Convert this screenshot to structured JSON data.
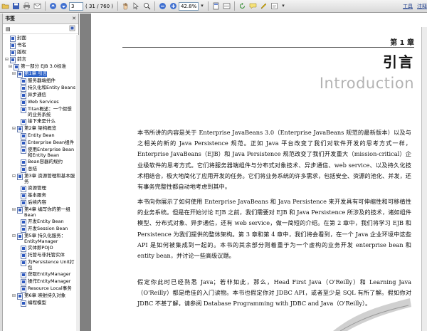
{
  "toolbar": {
    "page_current": "3",
    "page_total": "( 31 / 760 )",
    "zoom": "42.8%",
    "zoom_dropdown": "▾"
  },
  "menu": {
    "tools": "工具",
    "annotate": "注释"
  },
  "bookmarks": {
    "header": "书签",
    "close": "✕",
    "options": "▤",
    "items": [
      {
        "label": "封面",
        "indent": 0,
        "toggle": "",
        "selected": false
      },
      {
        "label": "书名",
        "indent": 0,
        "toggle": "",
        "selected": false
      },
      {
        "label": "版权",
        "indent": 0,
        "toggle": "",
        "selected": false
      },
      {
        "label": "前言",
        "indent": 0,
        "toggle": "⊟",
        "selected": false
      },
      {
        "label": "第一部分 EJB 3.0标准",
        "indent": 1,
        "toggle": "⊟",
        "selected": false
      },
      {
        "label": "第1章 引言",
        "indent": 2,
        "toggle": "⊟",
        "selected": true
      },
      {
        "label": "服务器端组件",
        "indent": 3,
        "toggle": "",
        "selected": false
      },
      {
        "label": "持久化和Entity Beans",
        "indent": 3,
        "toggle": "",
        "selected": false
      },
      {
        "label": "异步通信",
        "indent": 3,
        "toggle": "",
        "selected": false
      },
      {
        "label": "Web Services",
        "indent": 3,
        "toggle": "",
        "selected": false
      },
      {
        "label": "Titan概述：一个假想的业务系统",
        "indent": 3,
        "toggle": "",
        "selected": false
      },
      {
        "label": "接下来是什么",
        "indent": 3,
        "toggle": "",
        "selected": false
      },
      {
        "label": "第2章 架构概览",
        "indent": 2,
        "toggle": "⊟",
        "selected": false
      },
      {
        "label": "Entity Bean",
        "indent": 3,
        "toggle": "",
        "selected": false
      },
      {
        "label": "Enterprise Bean组件",
        "indent": 3,
        "toggle": "",
        "selected": false
      },
      {
        "label": "使用Enterprise Bean和Entity Bean",
        "indent": 3,
        "toggle": "",
        "selected": false
      },
      {
        "label": "Bean容器的规约",
        "indent": 3,
        "toggle": "",
        "selected": false
      },
      {
        "label": "总结",
        "indent": 3,
        "toggle": "",
        "selected": false
      },
      {
        "label": "第3章 资源管理和基本服务",
        "indent": 2,
        "toggle": "⊟",
        "selected": false
      },
      {
        "label": "资源管理",
        "indent": 3,
        "toggle": "",
        "selected": false
      },
      {
        "label": "基本服务",
        "indent": 3,
        "toggle": "",
        "selected": false
      },
      {
        "label": "后续内容",
        "indent": 3,
        "toggle": "",
        "selected": false
      },
      {
        "label": "第4章 编写你的第一组Bean",
        "indent": 2,
        "toggle": "⊟",
        "selected": false
      },
      {
        "label": "开发Entity Bean",
        "indent": 3,
        "toggle": "",
        "selected": false
      },
      {
        "label": "开发Session Bean",
        "indent": 3,
        "toggle": "",
        "selected": false
      },
      {
        "label": "第5章 持久化服务：EntityManager",
        "indent": 2,
        "toggle": "⊟",
        "selected": false
      },
      {
        "label": "实体即POJO",
        "indent": 3,
        "toggle": "",
        "selected": false
      },
      {
        "label": "托管与非托管实体",
        "indent": 3,
        "toggle": "",
        "selected": false
      },
      {
        "label": "为Persistence Unit打包",
        "indent": 3,
        "toggle": "",
        "selected": false
      },
      {
        "label": "获取EntityManager",
        "indent": 3,
        "toggle": "",
        "selected": false
      },
      {
        "label": "操作EntityManager",
        "indent": 3,
        "toggle": "",
        "selected": false
      },
      {
        "label": "Resource Local事务",
        "indent": 3,
        "toggle": "",
        "selected": false
      },
      {
        "label": "第6章 映射持久对象",
        "indent": 2,
        "toggle": "⊟",
        "selected": false
      },
      {
        "label": "编程模型",
        "indent": 3,
        "toggle": "",
        "selected": false
      }
    ]
  },
  "page": {
    "chapter_no": "第 1 章",
    "chapter_title": "引言",
    "chapter_en": "Introduction",
    "p1": "本书所讲的内容是关于 Enterprise JavaBeans 3.0（Enterprise JavaBeans 规范的最新版本）以及与之相关的新的 Java Persistence 规范。正如 Java 平台改变了我们对软件开发的思考方式一样，Enterprise JavaBeans（EJB）和 Java Persistence 规范改变了我们开发重大（mission-critical）企业级软件的思考方式。它们将服务器端组件与分布式对象技术、异步通信、web service、以及持久化技术相结合，极大地简化了应用开发的任务。它们将业务系统的许多需求，包括安全、资源的池化、并发，还有事务完整性都自动地考虑到其中。",
    "p2": "本书向你展示了如何使用 Enterprise JavaBeans 和 Java Persistence 来开发具有可伸缩性和可移植性的业务系统。但是在开始讨论 EJB 之前，我们需要对 EJB 和 Java Persistence 所涉及的技术，诸如组件模型、分布式对象、异步通信，还有 web service，做一简短的介绍。在第 2 章中，我们将学习 EJB 和 Persistence 为我们提供的整体架构。第 3 章和第 4 章中，我们将会看到，在一个 Java 企业环境中这些 API 是如何被集成到一起的。本书的其余部分则着重于为一个虚构的业务开发 enterprise bean 和 entity bean，并讨论一些高级议题。",
    "p3": "假定你此时已经熟悉 Java；若非如此，那么，Head First Java（O'Reilly）和 Learning Java（O'Reilly）都是绝佳的入门读物。本书也假定你对 JDBC API，或者至少是 SQL 有所了解。假如你对 JDBC 不甚了解，请参阅 Database Programming with JDBC and Java（O'Reilly）。"
  },
  "colors": {
    "selection": "#2f64c8",
    "doc_background": "#808080",
    "english_title": "#b3b3b3"
  }
}
